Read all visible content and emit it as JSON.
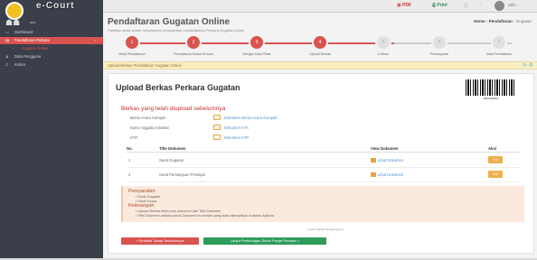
{
  "app": {
    "brand": "e-Court",
    "brand_sub": "Mahkamah Agung Republik Indonesia"
  },
  "topbar": {
    "pdf_label": "PDF",
    "print_label": "Print",
    "user_name": "adv..."
  },
  "sidebar": {
    "user_label": "adv",
    "items": [
      {
        "label": "Dashboard",
        "icon": "monitor-icon"
      },
      {
        "label": "Pendaftaran Perkara",
        "icon": "file-icon"
      },
      {
        "label": "Gugatan Online",
        "icon": "circle-icon"
      },
      {
        "label": "Data Pengguna",
        "icon": "user-icon"
      },
      {
        "label": "Keluar",
        "icon": "power-icon"
      }
    ]
  },
  "header": {
    "title": "Pendaftaran Gugatan Online",
    "subtitle": "Pastikan anda sudah menyiapkan persyaratan mendaftarkan Perkara Gugatan online",
    "breadcrumb": [
      "Home",
      "Pendaftaran",
      "Gugatan"
    ]
  },
  "stepper": {
    "steps": [
      {
        "label": "Mulai Pendaftaran",
        "num": "1",
        "done": true
      },
      {
        "label": "Pendaftaran Kuasa Khusus",
        "num": "2",
        "done": true
      },
      {
        "label": "Mengisi Data Pihak",
        "num": "3",
        "done": true
      },
      {
        "label": "Upload Berkas",
        "num": "4",
        "done": true
      },
      {
        "label": "e-Skum",
        "num": "5",
        "done": false
      },
      {
        "label": "Pembayaran",
        "num": "6",
        "done": false
      },
      {
        "label": "Data Pendaftaran",
        "num": "7",
        "done": false
      }
    ]
  },
  "notice": {
    "text": "Upload Berkas Pendaftaran Gugatan Online"
  },
  "card": {
    "title": "Upload Berkas Perkara Gugatan",
    "barcode_number": "ABCDE0001",
    "uploaded_heading": "Berkas yang telah diupload sebelumnya",
    "documents": [
      {
        "name": "Berita Acara Sumpah",
        "link": "Dokumen Berita Acara Sumpah"
      },
      {
        "name": "Kartu Anggota Advokat",
        "link": "Dokumen KTA"
      },
      {
        "name": "KTP",
        "link": "Dokumen KTP"
      }
    ],
    "table": {
      "headers": {
        "no": "No.",
        "title": "Title Dokumen",
        "view": "View Dokumen",
        "action": "Aksi"
      },
      "rows": [
        {
          "no": "1",
          "title": "Surat Gugatan",
          "view": "Lihat Dokumen",
          "action": "Edit"
        },
        {
          "no": "2",
          "title": "Surat Persetujuan Prinsipal",
          "view": "Lihat Dokumen",
          "action": "Edit"
        }
      ]
    },
    "requirements": {
      "title": "Persyaratan",
      "items": [
        "Surat Gugatan",
        "Surat Kuasa"
      ],
      "keterangan_title": "Keterangan",
      "keterangan": [
        "Upload Berkas telah pros dokumen dan Title Dokumen",
        "Title Dokumen adalah pokok Dokumen itu sendiri yang akan ditampilkan di dalam Aplikasi"
      ]
    },
    "captcha_text": "ecourt.mahkamahagung.go.id",
    "buttons": {
      "back": "< Kembali Tahap Sebelumnya",
      "next": "Lanjut Perhitungan Skum Panjar Perkara >"
    }
  },
  "colors": {
    "accent": "#d9534f",
    "sidebar": "#3a3f4a",
    "success": "#2e9c5a",
    "warning": "#f0ad4e",
    "link": "#4a8fd0"
  }
}
